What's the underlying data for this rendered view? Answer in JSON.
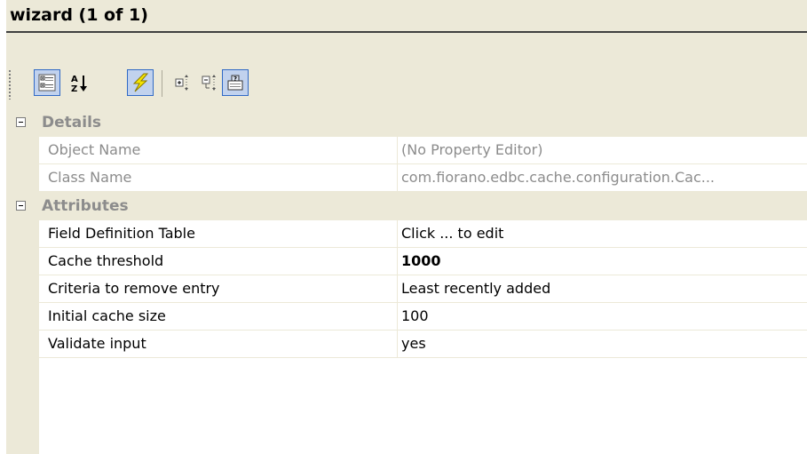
{
  "title": "wizard (1 of 1)",
  "toolbar": {
    "buttons": [
      {
        "icon": "categorized-icon",
        "pressed": true
      },
      {
        "icon": "alphabetical-sort-icon",
        "pressed": false
      },
      {
        "icon": "events-icon",
        "pressed": true
      },
      {
        "icon": "expand-all-icon",
        "pressed": false
      },
      {
        "icon": "collapse-all-icon",
        "pressed": false
      },
      {
        "icon": "property-pages-icon",
        "pressed": true
      }
    ]
  },
  "grid": {
    "categories": [
      {
        "label": "Details",
        "rows": [
          {
            "name": "Object Name",
            "value": "(No Property Editor)"
          },
          {
            "name": "Class Name",
            "value": "com.fiorano.edbc.cache.configuration.Cac..."
          }
        ]
      },
      {
        "label": "Attributes",
        "rows": [
          {
            "name": "Field Definition Table",
            "value": "Click ... to edit"
          },
          {
            "name": "Cache threshold",
            "value": "1000"
          },
          {
            "name": "Criteria to remove entry",
            "value": "Least recently added"
          },
          {
            "name": "Initial cache size",
            "value": "100"
          },
          {
            "name": "Validate input",
            "value": "yes"
          }
        ]
      }
    ]
  },
  "colors": {
    "panel_bg": "#ece9d8",
    "disabled_text": "#8c8c8c",
    "pressed_border": "#316ac5",
    "pressed_bg": "#c1d2ee"
  }
}
